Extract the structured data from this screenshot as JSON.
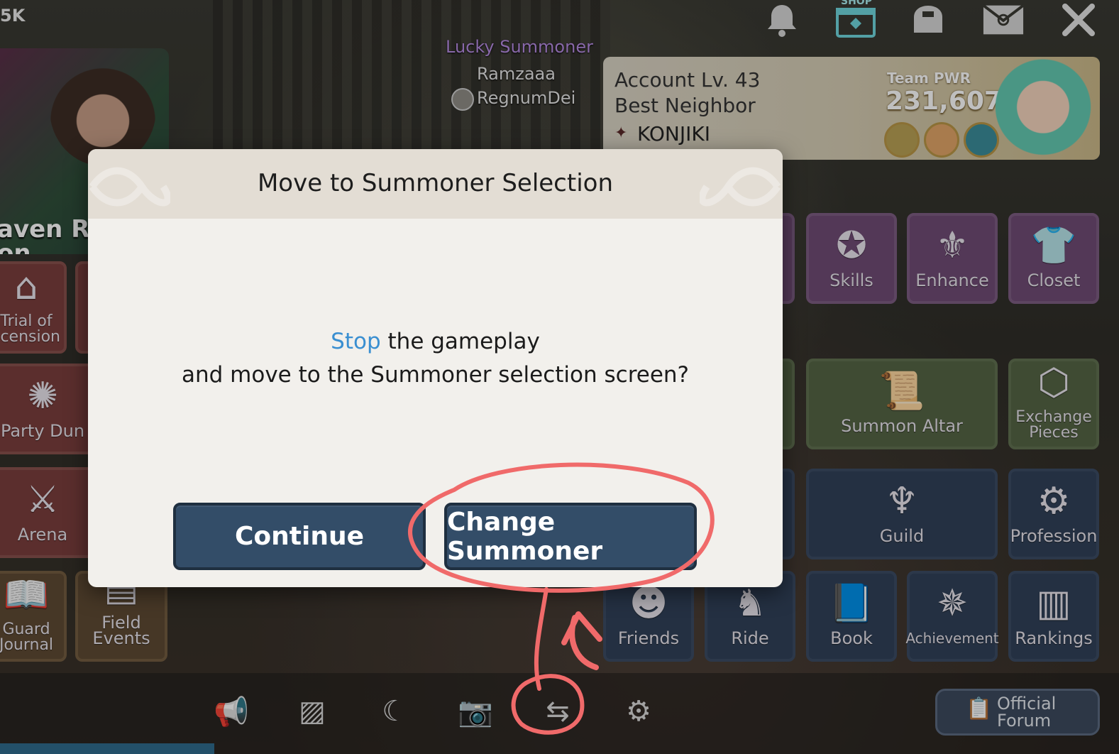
{
  "top": {
    "currency": "5K",
    "shop_label": "SHOP",
    "icons": [
      "bell-icon",
      "shop-icon",
      "backpack-icon",
      "mail-icon",
      "close-icon"
    ]
  },
  "event_banner": {
    "title": "aven Rat\non",
    "page_dots": 2
  },
  "player": {
    "badge": "Lucky Summoner",
    "name": "Ramzaaa",
    "guild": "RegnumDei"
  },
  "account": {
    "level": "Account Lv. 43",
    "title": "Best Neighbor",
    "guild": "KONJIKI",
    "team_pwr_label": "Team PWR",
    "team_pwr_value": "231,607"
  },
  "menu": {
    "skills": "Skills",
    "enhance": "Enhance",
    "closet": "Closet",
    "summon_altar": "Summon Altar",
    "exchange_pieces": "Exchange\nPieces",
    "guild": "Guild",
    "profession": "Profession",
    "friends": "Friends",
    "ride": "Ride",
    "book": "Book",
    "achievement": "Achievement",
    "rankings": "Rankings",
    "trial": "Trial of\nscension",
    "party": "Party Dun",
    "arena": "Arena",
    "guard_journal": "Guard\nJournal",
    "field_events": "Field Events"
  },
  "forum": {
    "label": "Official\nForum"
  },
  "dialog": {
    "title": "Move to Summoner Selection",
    "message_highlight": "Stop",
    "message_line1_rest": " the gameplay",
    "message_line2": "and move to the Summoner selection screen?",
    "continue_label": "Continue",
    "change_label": "Change Summoner"
  },
  "colors": {
    "highlight": "#3a8fd1",
    "button": "#334d68",
    "annotation": "#f06a6a"
  }
}
